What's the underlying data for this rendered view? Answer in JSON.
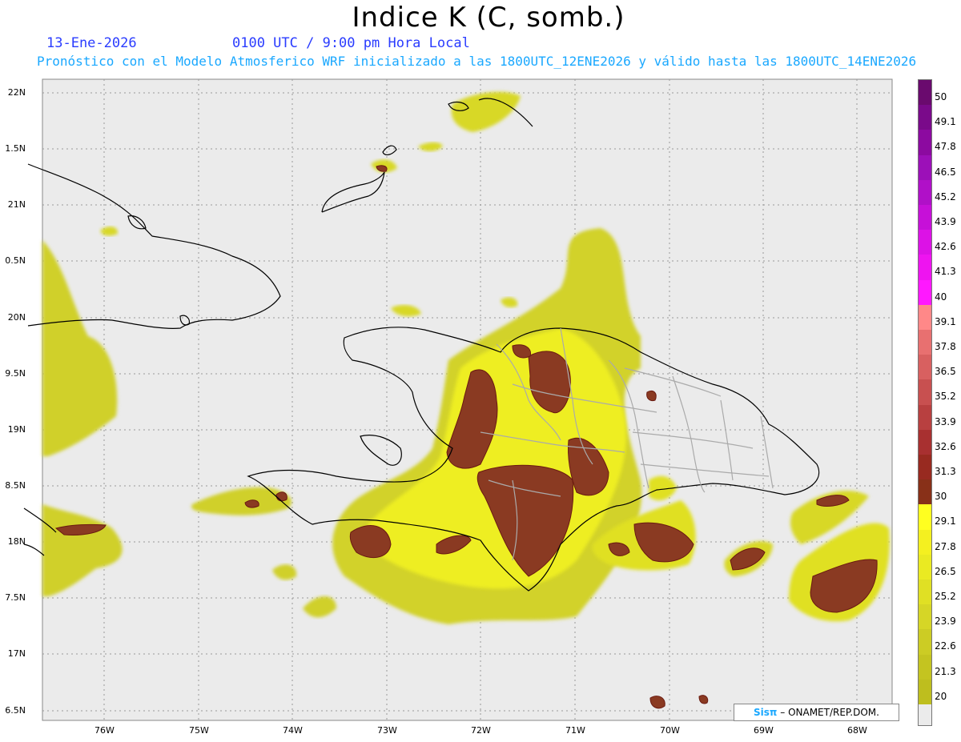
{
  "title": "Indice K (C, somb.)",
  "date": "13-Ene-2026",
  "time_label": "0100 UTC / 9:00 pm Hora Local",
  "model_info": "Pronóstico con el Modelo Atmosferico WRF inicializado a las 1800UTC_12ENE2026 y válido hasta las  1800UTC_14ENE2026",
  "lat_labels": [
    "22N",
    "1.5N",
    "21N",
    "0.5N",
    "20N",
    "9.5N",
    "19N",
    "8.5N",
    "18N",
    "7.5N",
    "17N",
    "6.5N"
  ],
  "lon_labels": [
    "76W",
    "75W",
    "74W",
    "73W",
    "72W",
    "71W",
    "70W",
    "69W",
    "68W"
  ],
  "colorbar": {
    "labels": [
      "50",
      "49.1",
      "47.8",
      "46.5",
      "45.2",
      "43.9",
      "42.6",
      "41.3",
      "40",
      "39.1",
      "37.8",
      "36.5",
      "35.2",
      "33.9",
      "32.6",
      "31.3",
      "30",
      "29.1",
      "27.8",
      "26.5",
      "25.2",
      "23.9",
      "22.6",
      "21.3",
      "20"
    ],
    "colors": [
      "#6a0a6e",
      "#7a0a8a",
      "#8c0aa0",
      "#9c10b8",
      "#b010c8",
      "#c610d8",
      "#dc12e6",
      "#ee14f0",
      "#ff18ff",
      "#ff8888",
      "#e87070",
      "#d86060",
      "#c85050",
      "#b84040",
      "#a83030",
      "#982a20",
      "#883018",
      "#ffff20",
      "#f4f020",
      "#eaea22",
      "#e0e024",
      "#d6d626",
      "#cccc24",
      "#c4c420",
      "#bebe1e"
    ],
    "below_color": "#ebebeb"
  },
  "credit": {
    "brand": "Sisπ",
    "text": "– ONAMET/REP.DOM."
  }
}
